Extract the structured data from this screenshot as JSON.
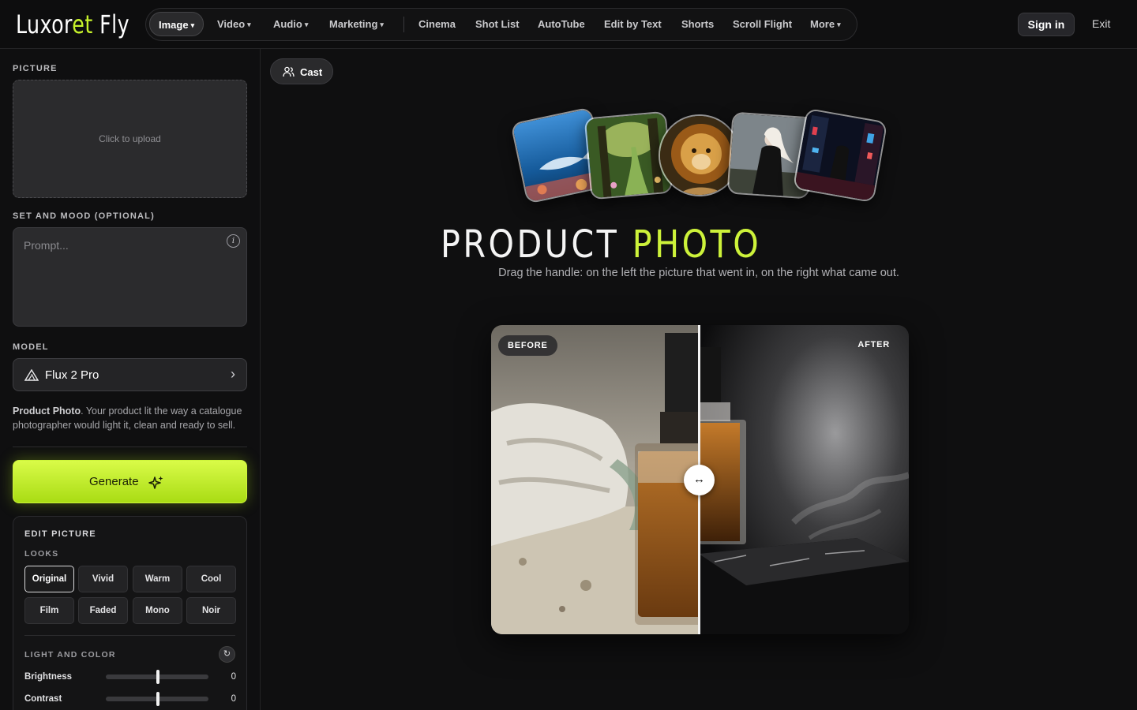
{
  "brand": {
    "name_a": "Luxor",
    "name_b": "et",
    "name_c": " Fly"
  },
  "nav": {
    "items": [
      {
        "label": "Image",
        "dropdown": true,
        "active": true
      },
      {
        "label": "Video",
        "dropdown": true
      },
      {
        "label": "Audio",
        "dropdown": true
      },
      {
        "label": "Marketing",
        "dropdown": true
      },
      {
        "label": "Cinema"
      },
      {
        "label": "Shot List"
      },
      {
        "label": "AutoTube"
      },
      {
        "label": "Edit by Text"
      },
      {
        "label": "Shorts"
      },
      {
        "label": "Scroll Flight"
      },
      {
        "label": "More",
        "dropdown": true
      }
    ],
    "chevron": "⌄"
  },
  "auth": {
    "signin": "Sign in",
    "exit": "Exit"
  },
  "sidebar": {
    "picture_label": "PICTURE",
    "upload_text": "Click to upload",
    "mood_label": "SET AND MOOD (OPTIONAL)",
    "prompt_placeholder": "Prompt...",
    "model_label": "MODEL",
    "model_name": "Flux 2 Pro",
    "desc_bold": "Product Photo",
    "desc_rest": ". Your product lit the way a catalogue photographer would light it, clean and ready to sell.",
    "generate_label": "Generate"
  },
  "edit": {
    "title": "EDIT PICTURE",
    "looks_label": "LOOKS",
    "looks": [
      "Original",
      "Vivid",
      "Warm",
      "Cool",
      "Film",
      "Faded",
      "Mono",
      "Noir"
    ],
    "selected_look": "Original",
    "light_label": "LIGHT AND COLOR",
    "sliders": [
      {
        "label": "Brightness",
        "value": "0"
      },
      {
        "label": "Contrast",
        "value": "0"
      }
    ]
  },
  "main": {
    "cast_label": "Cast",
    "title_a": "PRODUCT ",
    "title_b": "PHOTO",
    "subtitle": "Drag the handle: on the left the picture that went in, on the right what came out.",
    "before_label": "BEFORE",
    "after_label": "AFTER",
    "handle_glyph": "↔"
  },
  "colors": {
    "accent": "#c6f12b",
    "background": "#0f0f10",
    "panel": "#2b2b2d"
  }
}
